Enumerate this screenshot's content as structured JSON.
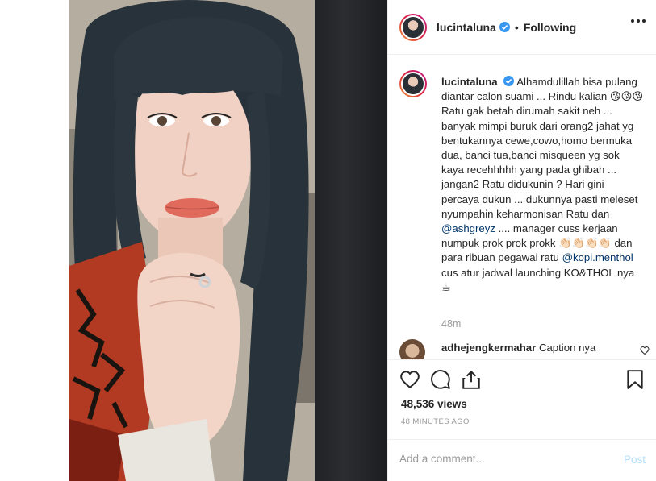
{
  "post": {
    "username": "lucintaluna",
    "follow_status": "Following",
    "separator": "•"
  },
  "caption": {
    "username": "lucintaluna",
    "pre_mention_1": "Alhamdulillah bisa pulang diantar calon suami ... Rindu kalian 😘😘😘 Ratu gak betah dirumah sakit neh ... banyak mimpi buruk dari orang2 jahat yg bentukannya cewe,cowo,homo bermuka dua, banci tua,banci misqueen yg sok kaya recehhhhh yang pada ghibah ... jangan2 Ratu didukunin ? Hari gini percaya dukun ... dukunnya pasti meleset nyumpahin keharmonisan Ratu dan",
    "mention_1": "@ashgreyz",
    "mid_text": ".... manager cuss kerjaan numpuk prok prok prokk 👏🏻👏🏻👏🏻👏🏻 dan para ribuan pegawai ratu",
    "mention_2": "@kopi.menthol",
    "post_text": "cus atur jadwal launching KO&THOL nya ☕",
    "time": "48m"
  },
  "comment": {
    "username": "adhejengkermahar",
    "text": "Caption nya"
  },
  "stats": {
    "views": "48,536 views",
    "posted_ago": "48 MINUTES AGO"
  },
  "compose": {
    "placeholder": "Add a comment...",
    "post_label": "Post"
  },
  "colors": {
    "verified": "#3897f0",
    "link": "#003569",
    "muted": "#999999",
    "post_disabled": "#b2dffc",
    "border": "#efefef"
  },
  "icons": [
    "verified-badge-icon",
    "more-options-icon",
    "heart-icon",
    "comment-icon",
    "share-icon",
    "bookmark-icon"
  ]
}
